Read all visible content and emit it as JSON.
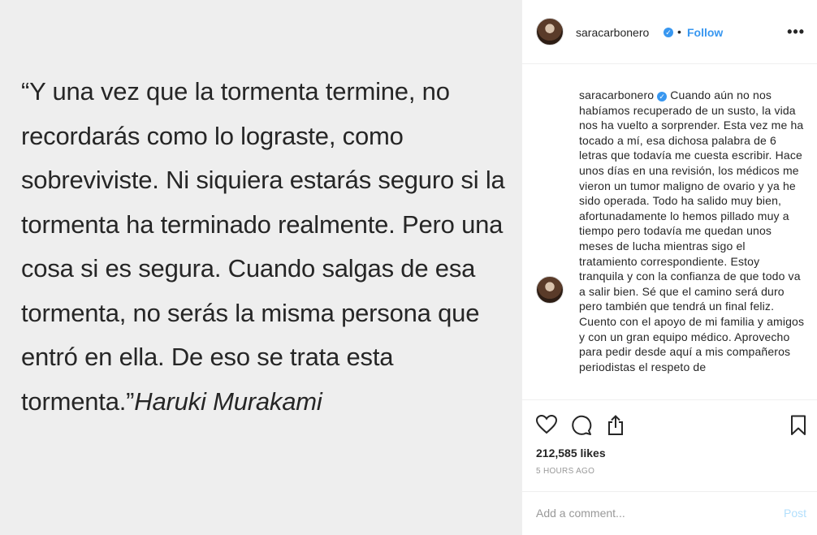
{
  "image": {
    "quote_text": "“Y una vez que la tormenta termine, no recordarás como lo lograste, como sobreviviste. Ni siquiera estarás seguro si la tormenta ha terminado realmente. Pero una cosa si es segura. Cuando salgas de esa tormenta, no serás la misma persona que entró en ella. De eso se trata esta tormenta.”",
    "quote_author": "Haruki Murakami"
  },
  "header": {
    "username": "saracarbonero",
    "separator": "•",
    "follow_label": "Follow",
    "more_label": "•••"
  },
  "caption": {
    "username": "saracarbonero",
    "text": "Cuando aún no nos habíamos recuperado de un susto, la vida nos ha vuelto a sorprender. Esta vez me ha tocado a mí, esa dichosa palabra de 6 letras que todavía me cuesta escribir. Hace unos días en una revisión, los médicos me vieron un tumor maligno de ovario y ya he sido operada. Todo ha salido muy bien, afortunadamente lo hemos pillado muy a tiempo pero todavía me quedan unos meses de lucha mientras sigo el tratamiento correspondiente. Estoy tranquila y con la confianza de que todo va a salir bien. Sé que el camino será duro pero también que tendrá un final feliz. Cuento con el apoyo de mi familia y amigos y con un gran equipo médico. Aprovecho para pedir desde aquí a mis compañeros periodistas el respeto de"
  },
  "stats": {
    "likes": "212,585 likes",
    "timestamp": "5 HOURS AGO"
  },
  "comment_box": {
    "placeholder": "Add a comment...",
    "post_label": "Post"
  },
  "colors": {
    "accent": "#3897f0",
    "image_bg": "#eeeeee",
    "text": "#262626",
    "muted": "#999999"
  },
  "icons": [
    "heart-icon",
    "comment-icon",
    "share-icon",
    "bookmark-icon",
    "verified-badge-icon",
    "more-options-icon"
  ]
}
